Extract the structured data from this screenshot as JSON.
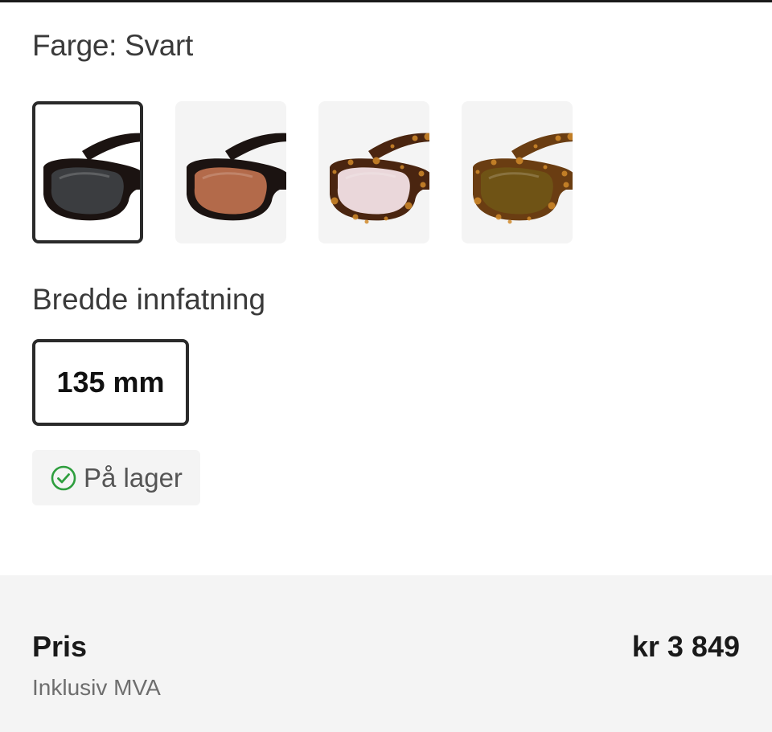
{
  "product_options": {
    "color_label": "Farge: Svart",
    "swatches": [
      {
        "name": "Svart",
        "frame_color": "#1b1311",
        "lens_color": "#3b3d40",
        "pattern": "solid",
        "selected": true
      },
      {
        "name": "Svart brun linse",
        "frame_color": "#1b1311",
        "lens_color": "#b36a4a",
        "pattern": "solid",
        "selected": false
      },
      {
        "name": "Havana rosa linse",
        "frame_color": "#4a2510",
        "lens_color": "#ead7da",
        "pattern": "tortoise",
        "selected": false
      },
      {
        "name": "Havana brun linse",
        "frame_color": "#6a3d12",
        "lens_color": "#6f5315",
        "pattern": "tortoise",
        "selected": false
      }
    ],
    "width_label": "Bredde innfatning",
    "width_value": "135 mm",
    "stock_status": "På lager",
    "stock_color": "#2e9e3e"
  },
  "price": {
    "label": "Pris",
    "vat_note": "Inklusiv MVA",
    "amount": "kr 3 849"
  }
}
